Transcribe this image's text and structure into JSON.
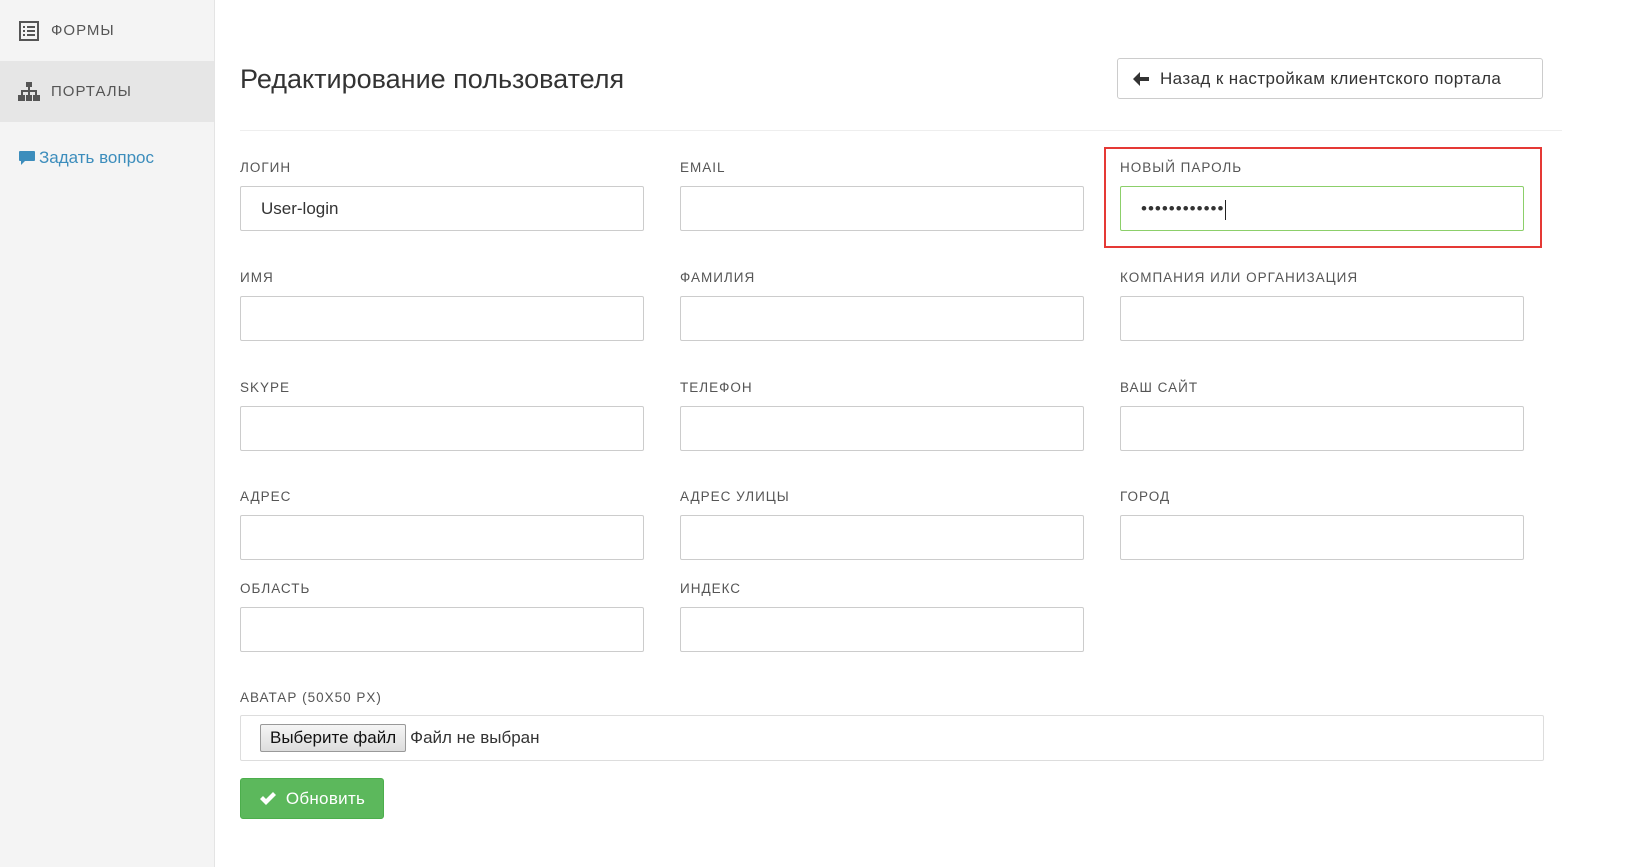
{
  "sidebar": {
    "items": [
      {
        "label": "ФОРМЫ",
        "icon": "list-icon",
        "active": false
      },
      {
        "label": "ПОРТАЛЫ",
        "icon": "sitemap-icon",
        "active": true
      }
    ],
    "ask_link": "Задать вопрос"
  },
  "main": {
    "title": "Редактирование пользователя",
    "back_button": "Назад к настройкам клиентского портала",
    "fields": {
      "login": {
        "label": "ЛОГИН",
        "value": "User-login"
      },
      "email": {
        "label": "EMAIL",
        "value": ""
      },
      "password": {
        "label": "НОВЫЙ ПАРОЛЬ",
        "value": "••••••••••••"
      },
      "first": {
        "label": "ИМЯ",
        "value": ""
      },
      "last": {
        "label": "ФАМИЛИЯ",
        "value": ""
      },
      "company": {
        "label": "КОМПАНИЯ ИЛИ ОРГАНИЗАЦИЯ",
        "value": ""
      },
      "skype": {
        "label": "SKYPE",
        "value": ""
      },
      "phone": {
        "label": "ТЕЛЕФОН",
        "value": ""
      },
      "site": {
        "label": "ВАШ САЙТ",
        "value": ""
      },
      "address": {
        "label": "АДРЕС",
        "value": ""
      },
      "street": {
        "label": "АДРЕС УЛИЦЫ",
        "value": ""
      },
      "city": {
        "label": "ГОРОД",
        "value": ""
      },
      "region": {
        "label": "ОБЛАСТЬ",
        "value": ""
      },
      "zip": {
        "label": "ИНДЕКС",
        "value": ""
      }
    },
    "avatar": {
      "label": "АВАТАР (50X50 PX)",
      "choose_button": "Выберите файл",
      "status": "Файл не выбран"
    },
    "submit_button": "Обновить"
  },
  "colors": {
    "sidebar_bg": "#f4f4f4",
    "link": "#3c8dbc",
    "success": "#5cb85c",
    "highlight": "#e53935",
    "focus_border": "#8ccf6a"
  }
}
